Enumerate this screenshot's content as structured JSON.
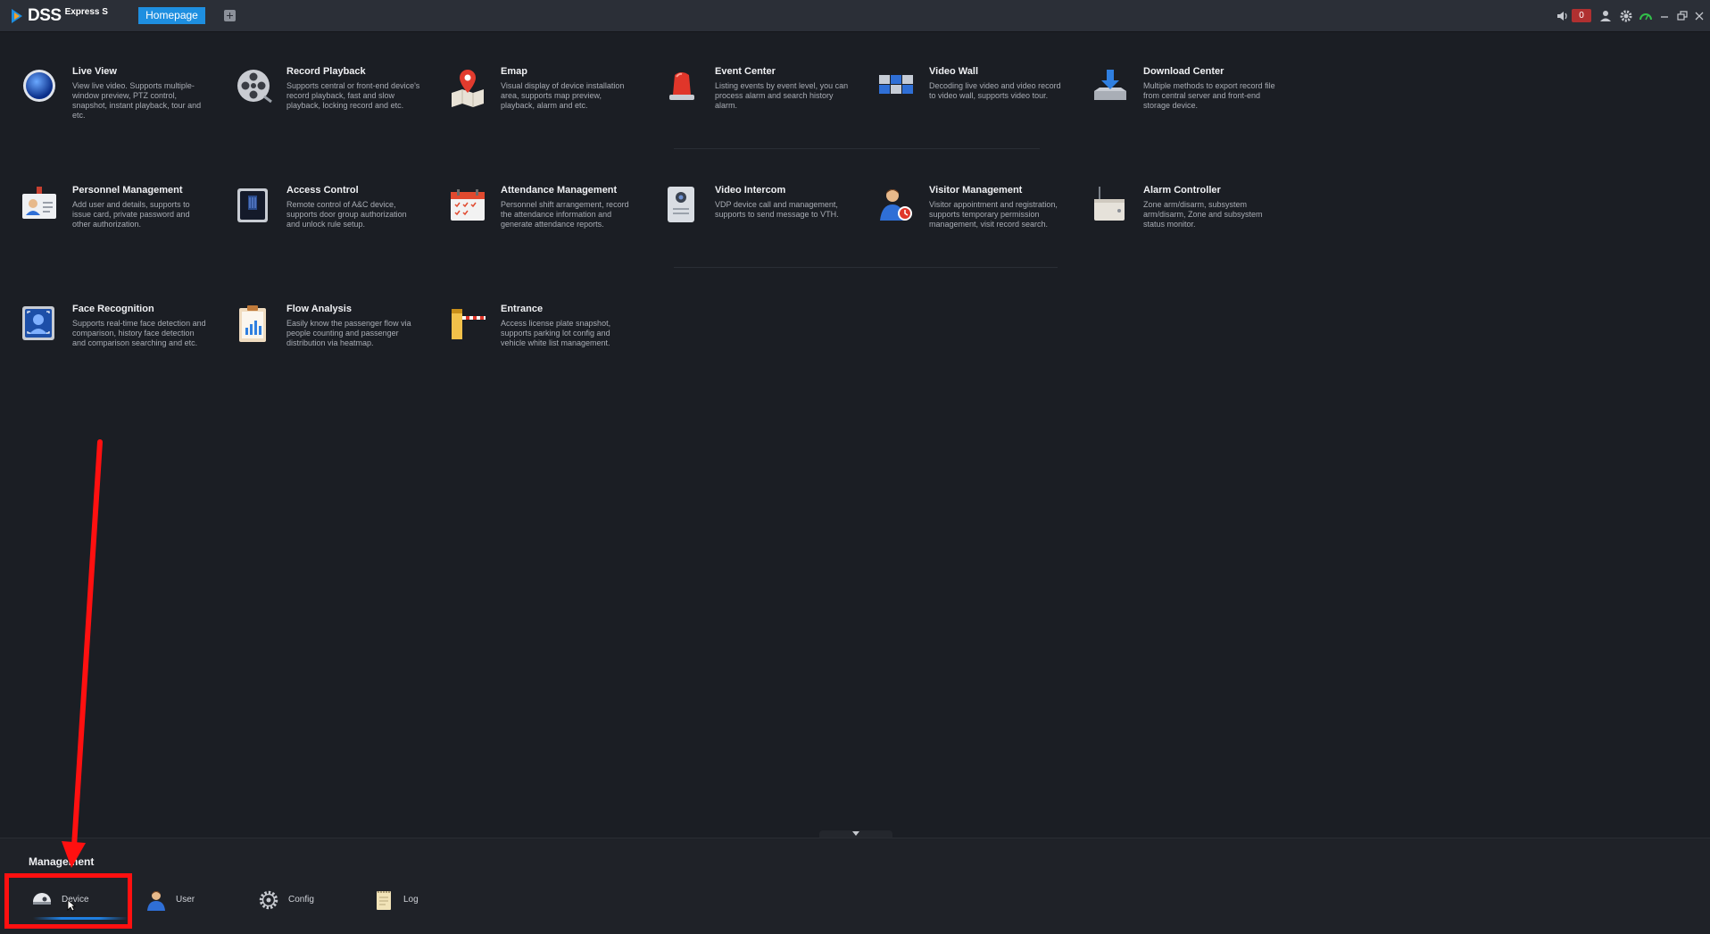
{
  "app": {
    "brand": "DSS",
    "edition": "Express S",
    "active_tab": "Homepage",
    "alarm_count": "0",
    "colors": {
      "accent": "#1e8fe0",
      "background": "#1b1e24",
      "topbar": "#2b2f37",
      "annotation": "#ff1010"
    }
  },
  "apps": [
    {
      "name": "Live View",
      "desc": "View live video. Supports multiple-window preview, PTZ control, snapshot, instant playback, tour and etc.",
      "icon": "live-view-globe-icon"
    },
    {
      "name": "Record Playback",
      "desc": "Supports central or front-end device's record playback, fast and slow playback, locking record and etc.",
      "icon": "film-reel-icon"
    },
    {
      "name": "Emap",
      "desc": "Visual display of device installation area, supports map preview, playback, alarm and etc.",
      "icon": "map-pin-icon"
    },
    {
      "name": "Event Center",
      "desc": "Listing events by event level, you can process alarm and search history alarm.",
      "icon": "alarm-beacon-icon"
    },
    {
      "name": "Video Wall",
      "desc": "Decoding live video and video record to video wall, supports video tour.",
      "icon": "video-wall-icon"
    },
    {
      "name": "Download Center",
      "desc": "Multiple methods to export record file from central server and front-end storage device.",
      "icon": "download-tray-icon"
    },
    {
      "name": "Personnel Management",
      "desc": "Add user and details, supports to issue card, private password and other authorization.",
      "icon": "id-badge-icon"
    },
    {
      "name": "Access Control",
      "desc": "Remote control of A&C device, supports door group authorization and unlock rule setup.",
      "icon": "door-panel-icon"
    },
    {
      "name": "Attendance Management",
      "desc": "Personnel shift arrangement, record the attendance information and generate attendance reports.",
      "icon": "calendar-check-icon"
    },
    {
      "name": "Video Intercom",
      "desc": "VDP device call and management, supports to send message to VTH.",
      "icon": "door-station-icon"
    },
    {
      "name": "Visitor Management",
      "desc": "Visitor appointment and registration, supports temporary permission management, visit record search.",
      "icon": "visitor-person-icon"
    },
    {
      "name": "Alarm Controller",
      "desc": "Zone arm/disarm, subsystem arm/disarm, Zone and subsystem status monitor.",
      "icon": "alarm-panel-icon"
    },
    {
      "name": "Face Recognition",
      "desc": "Supports real-time face detection and comparison, history face detection and comparison searching and etc.",
      "icon": "face-scan-icon"
    },
    {
      "name": "Flow Analysis",
      "desc": "Easily know the passenger flow via people counting and passenger distribution via heatmap.",
      "icon": "clipboard-chart-icon"
    },
    {
      "name": "Entrance",
      "desc": "Access license plate snapshot, supports parking lot config and vehicle white list management.",
      "icon": "barrier-gate-icon"
    }
  ],
  "management": {
    "title": "Management",
    "items": [
      {
        "label": "Device",
        "icon": "device-camera-icon"
      },
      {
        "label": "User",
        "icon": "user-person-icon"
      },
      {
        "label": "Config",
        "icon": "gear-icon"
      },
      {
        "label": "Log",
        "icon": "log-notepad-icon"
      }
    ]
  }
}
